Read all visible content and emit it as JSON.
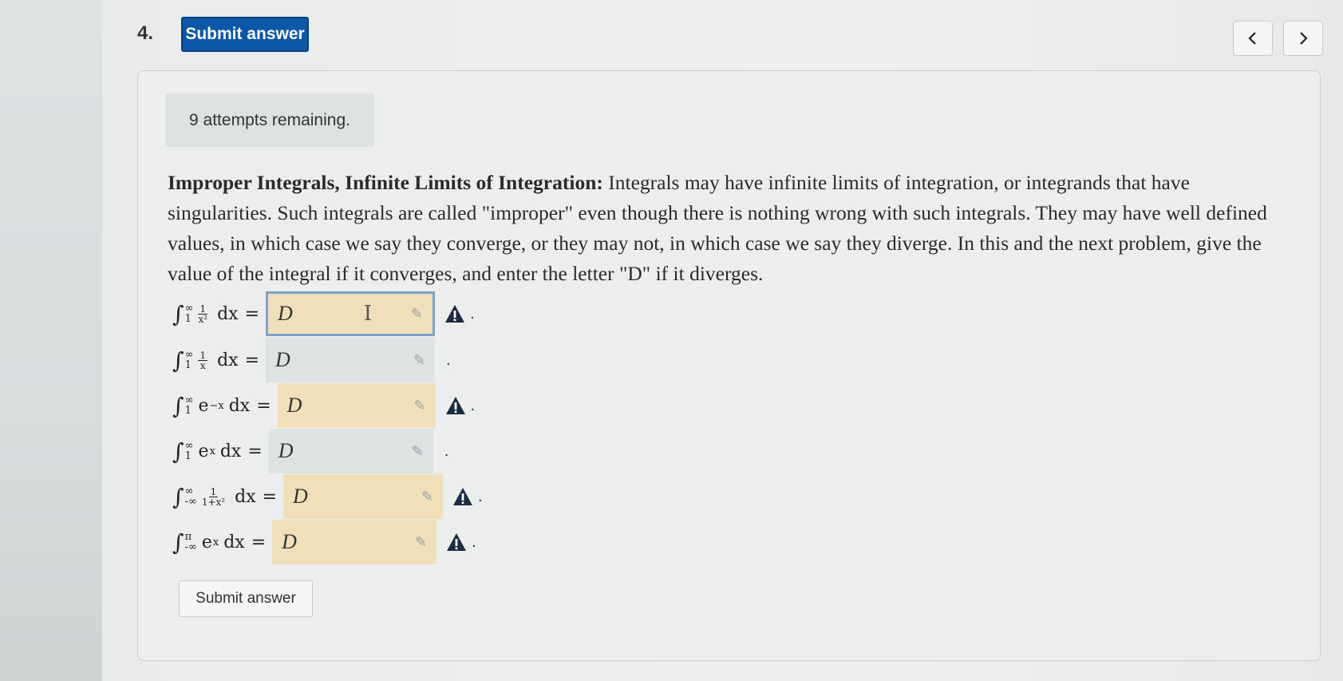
{
  "question": {
    "number": "4.",
    "submit_label": "Submit answer",
    "attempts": "9 attempts remaining."
  },
  "problem": {
    "title": "Improper Integrals, Infinite Limits of Integration:",
    "body": "Integrals may have infinite limits of integration, or integrands that have singularities. Such integrals are called \"improper\" even though there is nothing wrong with such integrals. They may have well defined values, in which case we say they converge, or they may not, in which case we say they diverge. In this and the next problem, give the value of the integral if it converges, and enter the letter \"D\" if it diverges."
  },
  "rows": [
    {
      "lower": "1",
      "upper": "∞",
      "integrand": "1/x²",
      "dx": "dx",
      "eq": "=",
      "answer": "D",
      "status": "warning"
    },
    {
      "lower": "1",
      "upper": "∞",
      "integrand": "1/x",
      "dx": "dx",
      "eq": "=",
      "answer": "D",
      "status": "ok"
    },
    {
      "lower": "1",
      "upper": "∞",
      "integrand": "e^-x",
      "dx": "dx",
      "eq": "=",
      "answer": "D",
      "status": "warning"
    },
    {
      "lower": "1",
      "upper": "∞",
      "integrand": "e^x",
      "dx": "dx",
      "eq": "=",
      "answer": "D",
      "status": "ok"
    },
    {
      "lower": "-∞",
      "upper": "∞",
      "integrand": "1/(1+x²)",
      "dx": "dx",
      "eq": "=",
      "answer": "D",
      "status": "warning"
    },
    {
      "lower": "-∞",
      "upper": "π",
      "integrand": "e^x",
      "dx": "dx",
      "eq": "=",
      "answer": "D",
      "status": "warning"
    }
  ],
  "math_parts": {
    "int": "∫",
    "one": "1",
    "xsq": "x²",
    "x": "x",
    "onepxsq": "1+x²",
    "e": "e",
    "neg_x": "−x",
    "x_exp": "x"
  },
  "punctuation": ".",
  "icons": {
    "warning": "warning-triangle-icon",
    "pencil": "pencil-icon",
    "prev": "chevron-left-icon",
    "next": "chevron-right-icon",
    "cursor": "text-cursor-icon"
  },
  "colors": {
    "primary": "#0d57a8",
    "warning_field": "#f0dfb9",
    "ok_field": "#dde2e3",
    "warning_icon": "#1c2a44"
  },
  "bottom_submit_label": "Submit answer"
}
